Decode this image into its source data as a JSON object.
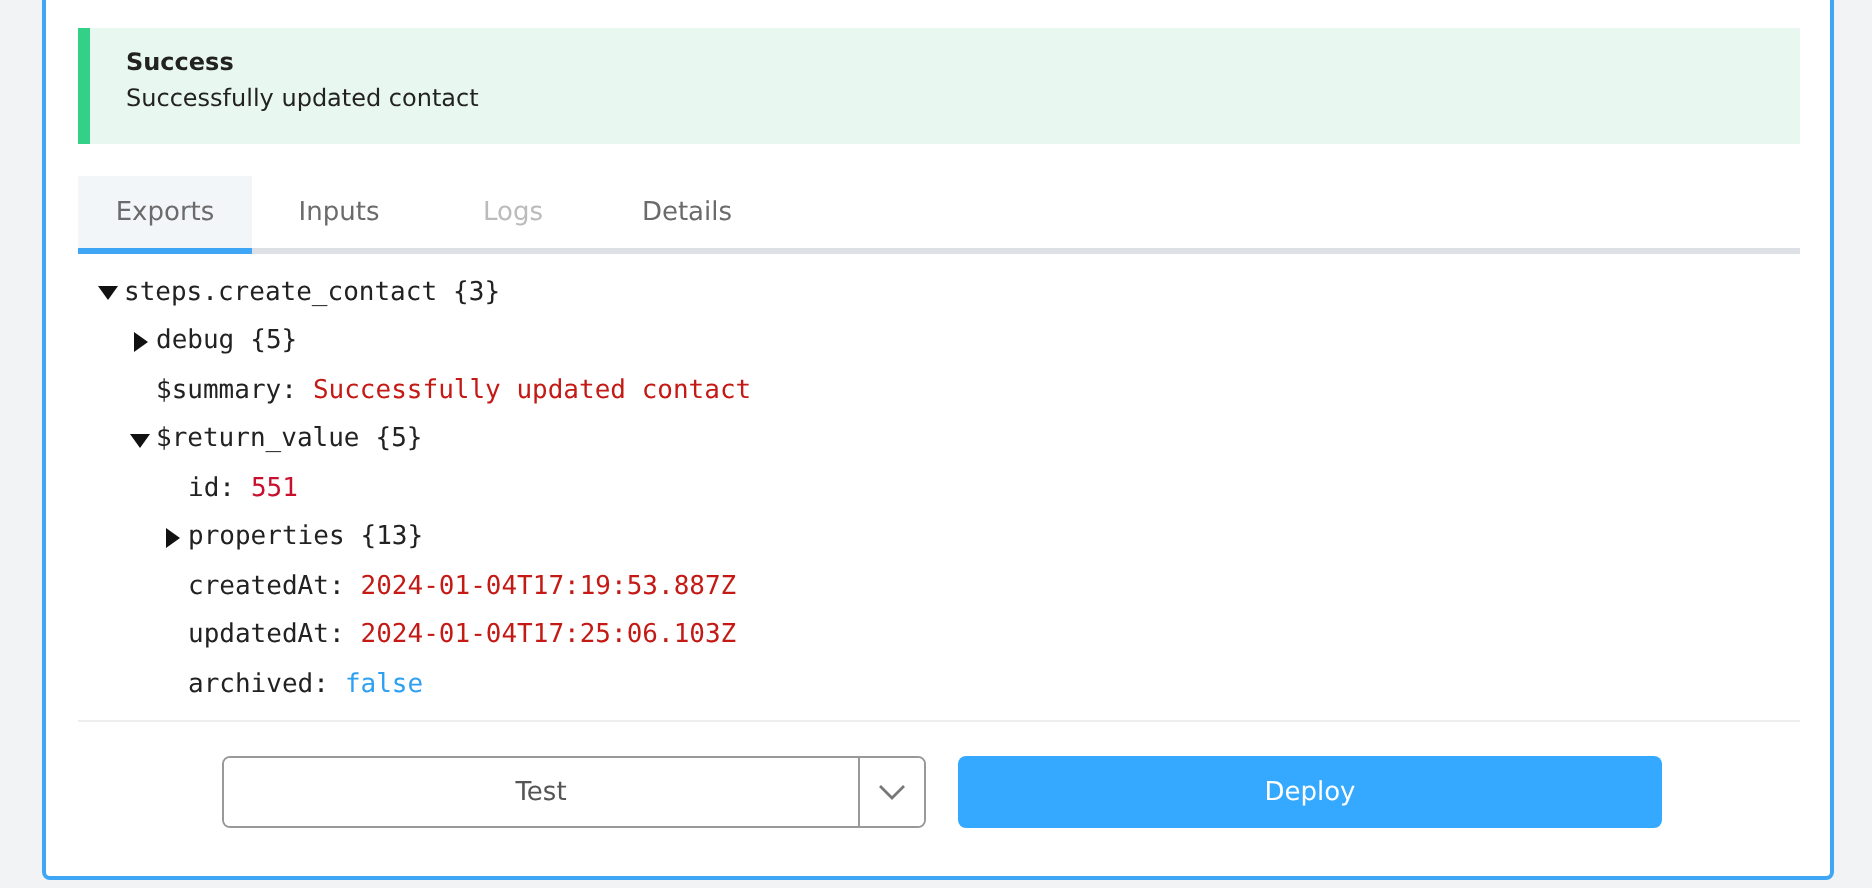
{
  "alert": {
    "title": "Success",
    "message": "Successfully updated contact"
  },
  "tabs": [
    {
      "label": "Exports",
      "selected": true,
      "disabled": false
    },
    {
      "label": "Inputs",
      "selected": false,
      "disabled": false
    },
    {
      "label": "Logs",
      "selected": false,
      "disabled": true
    },
    {
      "label": "Details",
      "selected": false,
      "disabled": false
    }
  ],
  "tree": [
    {
      "kind": "object",
      "key": "steps.create_contact",
      "count": "{3}",
      "expanded": true,
      "children": [
        {
          "kind": "object",
          "key": "debug",
          "count": "{5}",
          "expanded": false
        },
        {
          "kind": "string",
          "key": "$summary:",
          "value": "Successfully updated contact"
        },
        {
          "kind": "object",
          "key": "$return_value",
          "count": "{5}",
          "expanded": true,
          "children": [
            {
              "kind": "number",
              "key": "id:",
              "value": "551"
            },
            {
              "kind": "object",
              "key": "properties",
              "count": "{13}",
              "expanded": false
            },
            {
              "kind": "string",
              "key": "createdAt:",
              "value": "2024-01-04T17:19:53.887Z"
            },
            {
              "kind": "string",
              "key": "updatedAt:",
              "value": "2024-01-04T17:25:06.103Z"
            },
            {
              "kind": "boolean",
              "key": "archived:",
              "value": "false"
            }
          ]
        }
      ]
    }
  ],
  "footer": {
    "test_button": "Test",
    "deploy_button": "Deploy"
  }
}
